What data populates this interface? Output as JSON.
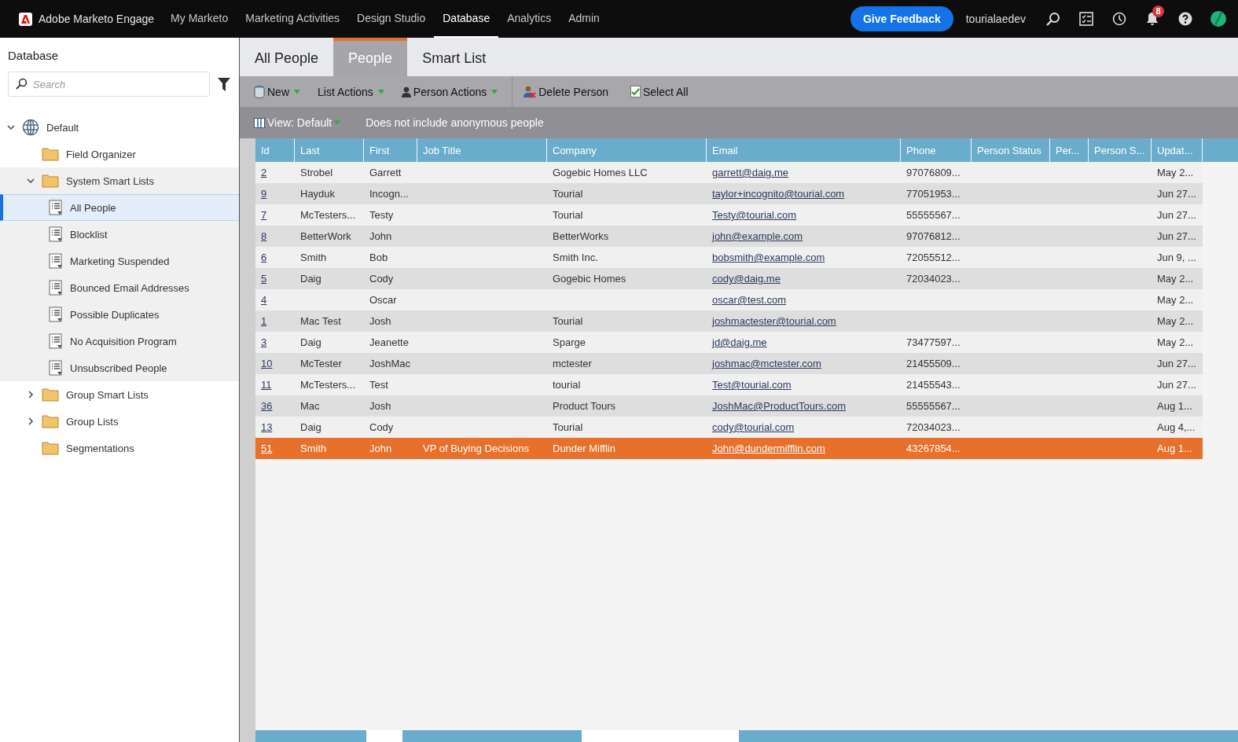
{
  "topbar": {
    "brand": "Adobe Marketo Engage",
    "nav": [
      {
        "label": "My Marketo",
        "selected": false
      },
      {
        "label": "Marketing Activities",
        "selected": false
      },
      {
        "label": "Design Studio",
        "selected": false
      },
      {
        "label": "Database",
        "selected": true
      },
      {
        "label": "Analytics",
        "selected": false
      },
      {
        "label": "Admin",
        "selected": false
      }
    ],
    "feedback_button": "Give Feedback",
    "username": "tourialaedev",
    "notifications_badge": "8"
  },
  "sidebar": {
    "title": "Database",
    "search": {
      "placeholder": "Search"
    },
    "tree": [
      {
        "label": "Default",
        "kind": "globe",
        "expanded": true,
        "selected": false,
        "children": [
          {
            "label": "Field Organizer",
            "kind": "folder",
            "selected": false
          },
          {
            "label": "System Smart Lists",
            "kind": "folder",
            "expanded": true,
            "selected": false,
            "children": [
              {
                "label": "All People",
                "kind": "list",
                "selected": true
              },
              {
                "label": "Blocklist",
                "kind": "list",
                "selected": false
              },
              {
                "label": "Marketing Suspended",
                "kind": "list",
                "selected": false
              },
              {
                "label": "Bounced Email Addresses",
                "kind": "list",
                "selected": false
              },
              {
                "label": "Possible Duplicates",
                "kind": "list",
                "selected": false
              },
              {
                "label": "No Acquisition Program",
                "kind": "list",
                "selected": false
              },
              {
                "label": "Unsubscribed People",
                "kind": "list",
                "selected": false
              }
            ]
          },
          {
            "label": "Group Smart Lists",
            "kind": "folder",
            "expanded": false,
            "selected": false
          },
          {
            "label": "Group Lists",
            "kind": "folder",
            "expanded": false,
            "selected": false
          },
          {
            "label": "Segmentations",
            "kind": "folder",
            "selected": false
          }
        ]
      }
    ]
  },
  "tabs": [
    {
      "label": "All People",
      "selected": false
    },
    {
      "label": "People",
      "selected": true
    },
    {
      "label": "Smart List",
      "selected": false
    }
  ],
  "toolbar": [
    {
      "label": "New",
      "menu": true
    },
    {
      "label": "List Actions",
      "menu": true
    },
    {
      "label": "Person Actions",
      "menu": true
    },
    {
      "label": "Delete Person",
      "menu": false
    },
    {
      "label": "Select All",
      "menu": false
    }
  ],
  "view_bar": {
    "view": "View: Default",
    "note": "Does not include anonymous people"
  },
  "table": {
    "columns": [
      "Id",
      "Last",
      "First",
      "Job Title",
      "Company",
      "Email",
      "Phone",
      "Person Status",
      "Per...",
      "Person S...",
      "Updat..."
    ],
    "rows": [
      {
        "cells": [
          "2",
          "Strobel",
          "Garrett",
          "",
          "Gogebic Homes LLC",
          "garrett@daig.me",
          "97076809...",
          "",
          "",
          "",
          "May 2..."
        ],
        "selected": false
      },
      {
        "cells": [
          "9",
          "Hayduk",
          "Incogn...",
          "",
          "Tourial",
          "taylor+incognito@tourial.com",
          "77051953...",
          "",
          "",
          "",
          "Jun 27..."
        ],
        "selected": false
      },
      {
        "cells": [
          "7",
          "McTesters...",
          "Testy",
          "",
          "Tourial",
          "Testy@tourial.com",
          "55555567...",
          "",
          "",
          "",
          "Jun 27..."
        ],
        "selected": false
      },
      {
        "cells": [
          "8",
          "BetterWork",
          "John",
          "",
          "BetterWorks",
          "john@example.com",
          "97076812...",
          "",
          "",
          "",
          "Jun 27..."
        ],
        "selected": false
      },
      {
        "cells": [
          "6",
          "Smith",
          "Bob",
          "",
          "Smith Inc.",
          "bobsmith@example.com",
          "72055512...",
          "",
          "",
          "",
          "Jun 9, ..."
        ],
        "selected": false
      },
      {
        "cells": [
          "5",
          "Daig",
          "Cody",
          "",
          "Gogebic Homes",
          "cody@daig.me",
          "72034023...",
          "",
          "",
          "",
          "May 2..."
        ],
        "selected": false
      },
      {
        "cells": [
          "4",
          "",
          "Oscar",
          "",
          "",
          "oscar@test.com",
          "",
          "",
          "",
          "",
          "May 2..."
        ],
        "selected": false
      },
      {
        "cells": [
          "1",
          "Mac Test",
          "Josh",
          "",
          "Tourial",
          "joshmactester@tourial.com",
          "",
          "",
          "",
          "",
          "May 2..."
        ],
        "selected": false
      },
      {
        "cells": [
          "3",
          "Daig",
          "Jeanette",
          "",
          "Sparge",
          "jd@daig.me",
          "73477597...",
          "",
          "",
          "",
          "May 2..."
        ],
        "selected": false
      },
      {
        "cells": [
          "10",
          "McTester",
          "JoshMac",
          "",
          "mctester",
          "joshmac@mctester.com",
          "21455509...",
          "",
          "",
          "",
          "Jun 27..."
        ],
        "selected": false
      },
      {
        "cells": [
          "11",
          "McTesters...",
          "Test",
          "",
          "tourial",
          "Test@tourial.com",
          "21455543...",
          "",
          "",
          "",
          "Jun 27..."
        ],
        "selected": false
      },
      {
        "cells": [
          "36",
          "Mac",
          "Josh",
          "",
          "Product Tours",
          "JoshMac@ProductTours.com",
          "55555567...",
          "",
          "",
          "",
          "Aug 1..."
        ],
        "selected": false
      },
      {
        "cells": [
          "13",
          "Daig",
          "Cody",
          "",
          "Tourial",
          "cody@tourial.com",
          "72034023...",
          "",
          "",
          "",
          "Aug 4,..."
        ],
        "selected": false
      },
      {
        "cells": [
          "51",
          "Smith",
          "John",
          "VP of Buying Decisions",
          "Dunder Mifflin",
          "John@dundermifflin.com",
          "43267854...",
          "",
          "",
          "",
          "Aug 1..."
        ],
        "selected": true
      }
    ]
  }
}
